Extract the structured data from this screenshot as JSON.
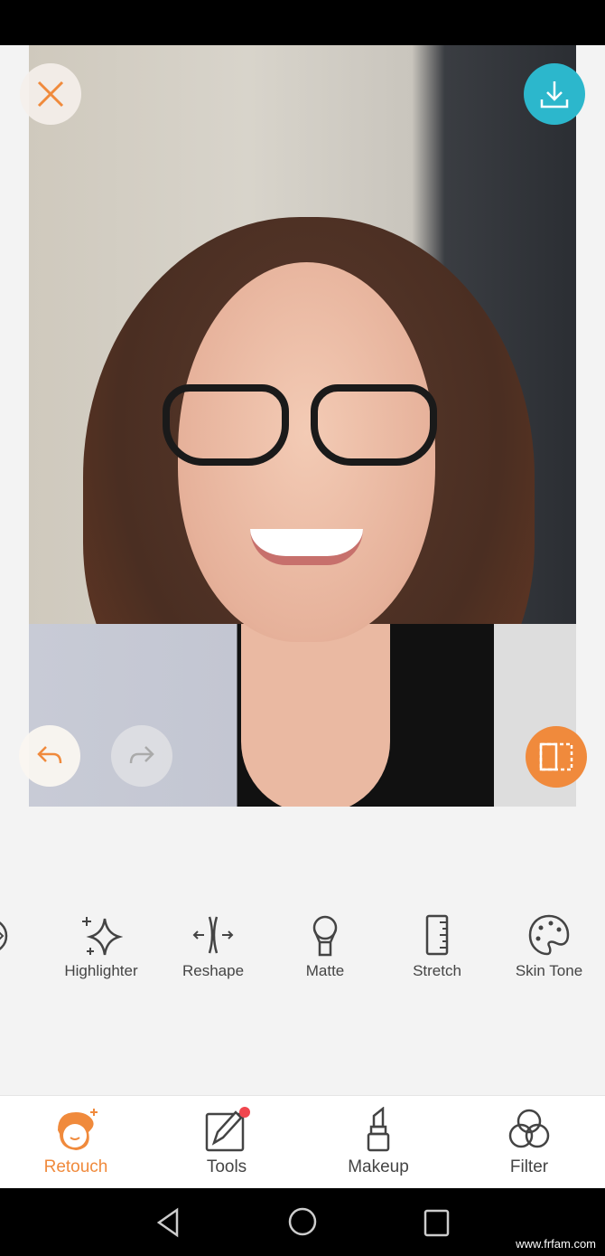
{
  "photo_controls": {
    "close": "close-icon",
    "download": "download-icon",
    "undo": "undo-icon",
    "redo": "redo-icon",
    "compare": "compare-icon"
  },
  "tools": [
    {
      "label": "ze"
    },
    {
      "label": "Highlighter"
    },
    {
      "label": "Reshape"
    },
    {
      "label": "Matte"
    },
    {
      "label": "Stretch"
    },
    {
      "label": "Skin Tone"
    }
  ],
  "tabs": [
    {
      "label": "Retouch",
      "active": true
    },
    {
      "label": "Tools",
      "badge": true
    },
    {
      "label": "Makeup"
    },
    {
      "label": "Filter"
    }
  ],
  "colors": {
    "accent": "#f08a3c",
    "download": "#2cb7cc",
    "badge": "#f0464e"
  },
  "watermark": "www.frfam.com"
}
